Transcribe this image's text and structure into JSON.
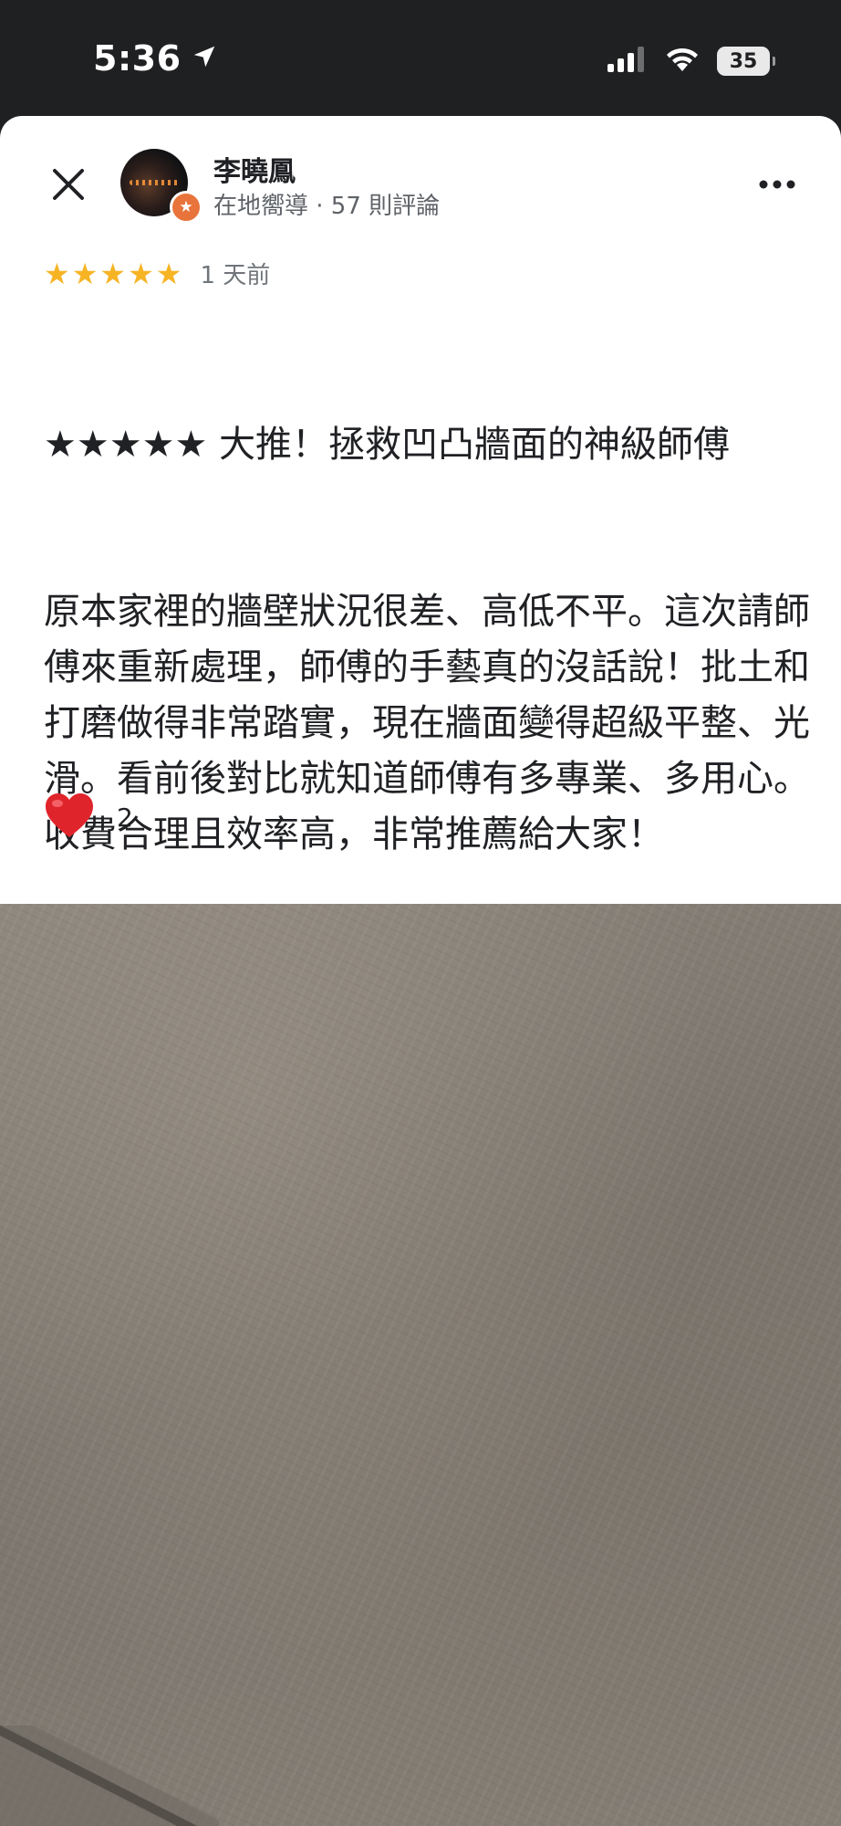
{
  "status_bar": {
    "time": "5:36",
    "battery": "35"
  },
  "review": {
    "user_name": "李曉鳳",
    "user_meta": "在地嚮導 · 57 則評論",
    "rating": 5,
    "time_ago": "1 天前",
    "title": "★★★★★ 大推！拯救凹凸牆面的神級師傅",
    "body": "原本家裡的牆壁狀況很差、高低不平。這次請師傅來重新處理，師傅的手藝真的沒話說！批土和打磨做得非常踏實，現在牆面變得超級平整、光滑。看前後對比就知道師傅有多專業、多用心。收費合理且效率高，非常推薦給大家！",
    "likes": "2"
  },
  "colors": {
    "star": "#f6b425",
    "badge": "#e8743b",
    "heart": "#e0242b"
  },
  "icons": {
    "close": "close-icon",
    "more": "more-icon",
    "heart": "heart-icon",
    "location": "location-arrow-icon",
    "signal": "signal-icon",
    "wifi": "wifi-icon",
    "battery": "battery-icon",
    "badge": "local-guide-star-icon"
  }
}
